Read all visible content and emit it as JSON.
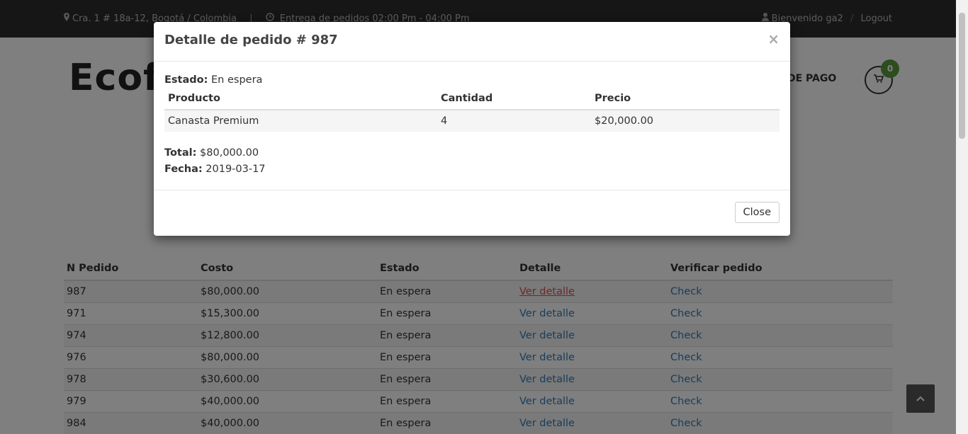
{
  "topbar": {
    "address": "Cra. 1 # 18a-12, Bogotá / Colombia",
    "separator": "|",
    "delivery": "Entrega de pedidos 02:00 Pm - 04:00 Pm",
    "welcome": "Bienvenido ga2",
    "slash": "/",
    "logout": "Logout"
  },
  "header": {
    "brand": "Ecofo",
    "nav_pay": "S DE PAGO",
    "cart_count": "0"
  },
  "orders": {
    "headers": [
      "N Pedido",
      "Costo",
      "Estado",
      "Detalle",
      "Verificar pedido"
    ],
    "rows": [
      {
        "id": "987",
        "cost": "$80,000.00",
        "status": "En espera",
        "detail": "Ver detalle",
        "check": "Check"
      },
      {
        "id": "971",
        "cost": "$15,300.00",
        "status": "En espera",
        "detail": "Ver detalle",
        "check": "Check"
      },
      {
        "id": "974",
        "cost": "$12,800.00",
        "status": "En espera",
        "detail": "Ver detalle",
        "check": "Check"
      },
      {
        "id": "976",
        "cost": "$80,000.00",
        "status": "En espera",
        "detail": "Ver detalle",
        "check": "Check"
      },
      {
        "id": "978",
        "cost": "$30,600.00",
        "status": "En espera",
        "detail": "Ver detalle",
        "check": "Check"
      },
      {
        "id": "979",
        "cost": "$40,000.00",
        "status": "En espera",
        "detail": "Ver detalle",
        "check": "Check"
      },
      {
        "id": "984",
        "cost": "$40,000.00",
        "status": "En espera",
        "detail": "Ver detalle",
        "check": "Check"
      }
    ]
  },
  "modal": {
    "title": "Detalle de pedido # 987",
    "close_x": "×",
    "status_label": "Estado:",
    "status_value": "En espera",
    "table_headers": [
      "Producto",
      "Cantidad",
      "Precio"
    ],
    "items": [
      {
        "product": "Canasta Premium",
        "qty": "4",
        "price": "$20,000.00"
      }
    ],
    "total_label": "Total:",
    "total_value": "$80,000.00",
    "date_label": "Fecha:",
    "date_value": "2019-03-17",
    "close_button": "Close"
  },
  "colors": {
    "topbar_bg": "#2c2c2c",
    "link": "#337ab7",
    "active_link": "#d9534f",
    "badge": "#5a9a3c"
  }
}
